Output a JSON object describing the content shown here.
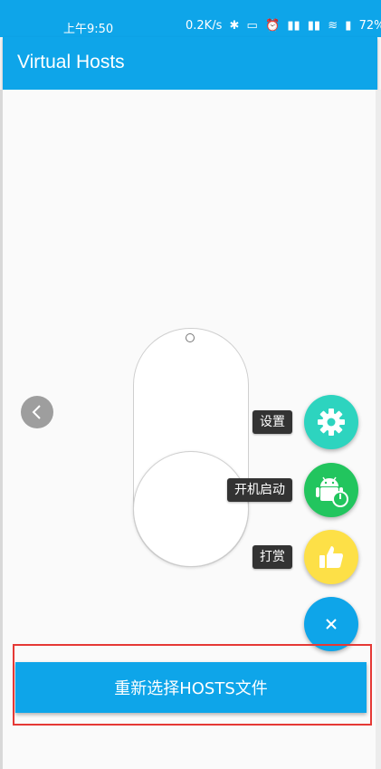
{
  "status_bar": {
    "time": "上午9:50",
    "net_speed": "0.2K/s",
    "battery": "72%"
  },
  "app_bar": {
    "title": "Virtual Hosts"
  },
  "fab_menu": {
    "items": [
      {
        "label": "设置",
        "icon": "gear-icon",
        "color": "#2dd4bf"
      },
      {
        "label": "开机启动",
        "icon": "android-power-icon",
        "color": "#22c55e"
      },
      {
        "label": "打赏",
        "icon": "thumbs-up-icon",
        "color": "#fde047"
      }
    ],
    "toggle_icon": "close-icon",
    "toggle_color": "#0ea5e9"
  },
  "main_button": {
    "label": "重新选择HOSTS文件"
  },
  "colors": {
    "primary": "#0ea5e9",
    "highlight": "#e53935"
  }
}
